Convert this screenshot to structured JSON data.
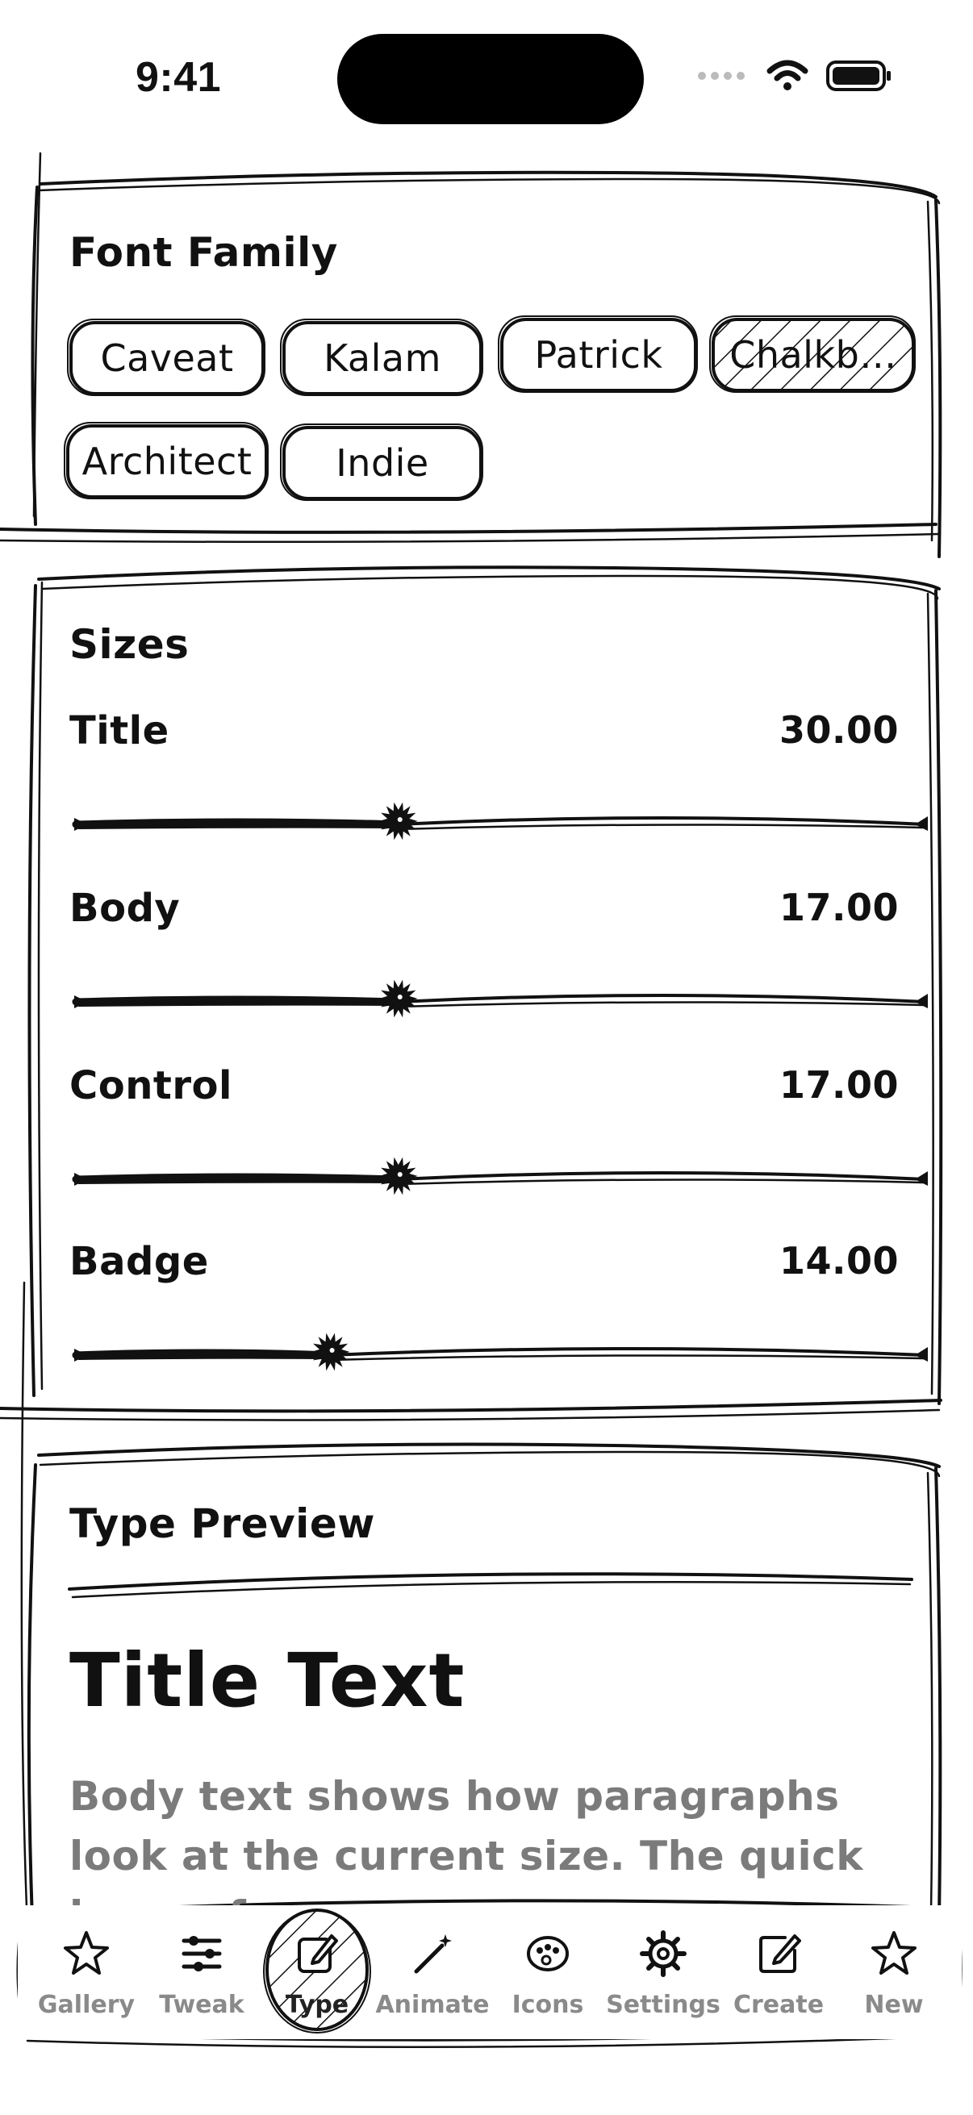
{
  "status_bar": {
    "time": "9:41"
  },
  "font_family": {
    "title": "Font Family",
    "chips": [
      {
        "label": "Caveat",
        "selected": false
      },
      {
        "label": "Kalam",
        "selected": false
      },
      {
        "label": "Patrick",
        "selected": false
      },
      {
        "label": "Chalkb…",
        "selected": true
      },
      {
        "label": "Architect",
        "selected": false
      },
      {
        "label": "Indie",
        "selected": false
      }
    ]
  },
  "sizes": {
    "title": "Sizes",
    "rows": [
      {
        "label": "Title",
        "value": "30.00",
        "fraction": 0.38
      },
      {
        "label": "Body",
        "value": "17.00",
        "fraction": 0.38
      },
      {
        "label": "Control",
        "value": "17.00",
        "fraction": 0.38
      },
      {
        "label": "Badge",
        "value": "14.00",
        "fraction": 0.3
      }
    ]
  },
  "type_preview": {
    "title": "Type Preview",
    "sample_title": "Title Text",
    "sample_body": "Body text shows how paragraphs look at the current size. The quick brown fox"
  },
  "tab_bar": {
    "tabs": [
      {
        "label": "Gallery",
        "icon": "star-icon",
        "active": false
      },
      {
        "label": "Tweak",
        "icon": "sliders-icon",
        "active": false
      },
      {
        "label": "Type",
        "icon": "edit-icon",
        "active": true
      },
      {
        "label": "Animate",
        "icon": "wand-icon",
        "active": false
      },
      {
        "label": "Icons",
        "icon": "palette-icon",
        "active": false
      },
      {
        "label": "Settings",
        "icon": "gear-icon",
        "active": false
      },
      {
        "label": "Create",
        "icon": "compose-icon",
        "active": false
      },
      {
        "label": "New",
        "icon": "star-icon",
        "active": false
      }
    ]
  },
  "colors": {
    "ink": "#111111",
    "muted_text": "#7b7b7b",
    "tab_label": "#8a8a8a",
    "background": "#ffffff"
  }
}
